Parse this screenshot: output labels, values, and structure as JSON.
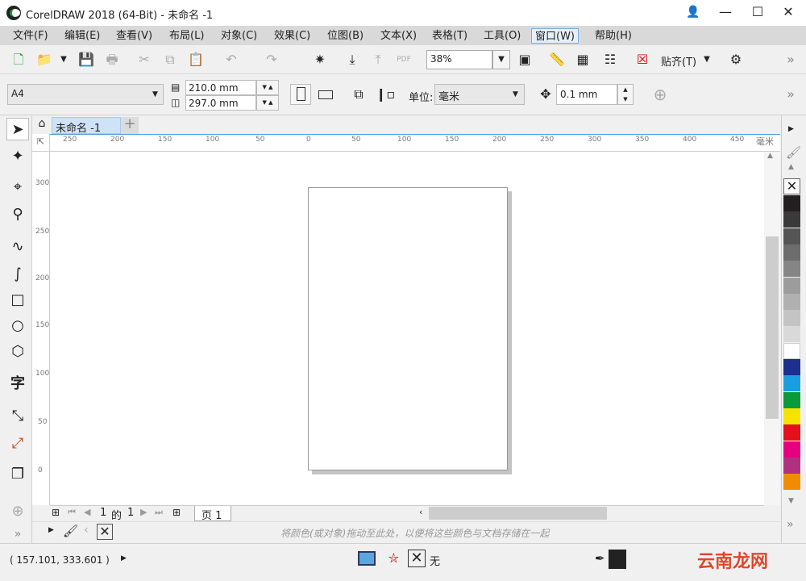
{
  "title": "CorelDRAW 2018 (64-Bit) - 未命名 -1",
  "menu": [
    "文件(F)",
    "编辑(E)",
    "查看(V)",
    "布局(L)",
    "对象(C)",
    "效果(C)",
    "位图(B)",
    "文本(X)",
    "表格(T)",
    "工具(O)",
    "窗口(W)",
    "帮助(H)"
  ],
  "toolbar": {
    "zoom": "38%",
    "snap_label": "贴齐(T)"
  },
  "props": {
    "page_size": "A4",
    "width": "210.0 mm",
    "height": "297.0 mm",
    "unit_label": "单位:",
    "unit": "毫米",
    "nudge": "0.1 mm"
  },
  "doc_tab": "未命名 -1",
  "ruler_unit": "毫米",
  "ruler_h": [
    "250",
    "200",
    "150",
    "100",
    "50",
    "0",
    "50",
    "100",
    "150",
    "200",
    "250",
    "300",
    "350",
    "400",
    "450"
  ],
  "ruler_v": [
    "300",
    "250",
    "200",
    "150",
    "100",
    "50",
    "0"
  ],
  "pager": {
    "current": "1",
    "of": "的",
    "total": "1",
    "page_tab": "页 1"
  },
  "tray_hint": "将颜色(或对象)拖动至此处，以便将这些颜色与文档存储在一起",
  "status": {
    "coords": "( 157.101, 333.601 )",
    "fill": "无"
  },
  "watermark": "云南龙网",
  "palette": [
    "#231f20",
    "#3a3a3a",
    "#555555",
    "#6d6d6d",
    "#858585",
    "#9c9c9c",
    "#b0b0b0",
    "#c4c4c4",
    "#d9d9d9",
    "#ffffff",
    "#1d2f8f",
    "#1a9ee0",
    "#0a9a3a",
    "#f5e400",
    "#e4101a",
    "#e4007e",
    "#b0307f",
    "#f08c00"
  ]
}
